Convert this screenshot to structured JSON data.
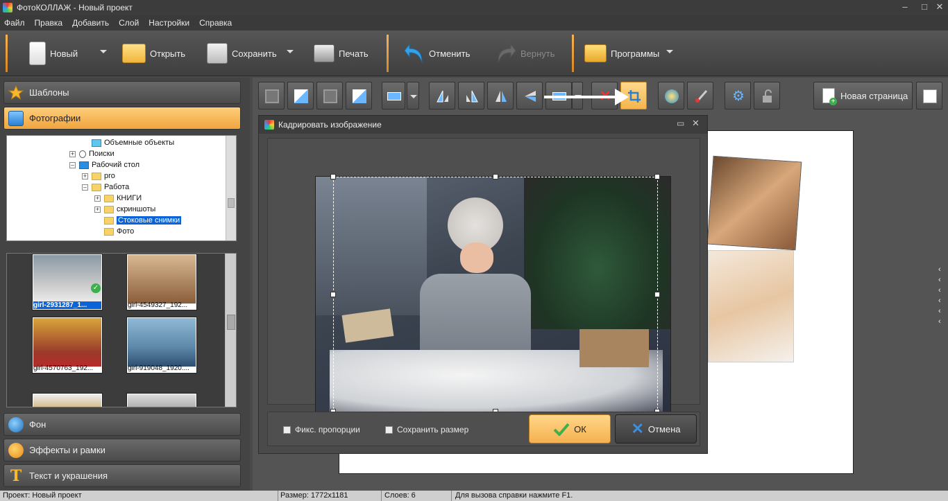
{
  "window": {
    "title": "ФотоКОЛЛАЖ - Новый проект",
    "minimize": "–",
    "maximize": "□",
    "close": "✕"
  },
  "menu": [
    "Файл",
    "Правка",
    "Добавить",
    "Слой",
    "Настройки",
    "Справка"
  ],
  "toolbar": {
    "new": "Новый",
    "open": "Открыть",
    "save": "Сохранить",
    "print": "Печать",
    "undo": "Отменить",
    "redo": "Вернуть",
    "programs": "Программы"
  },
  "left": {
    "templates": "Шаблоны",
    "photos": "Фотографии",
    "background": "Фон",
    "effects": "Эффекты и рамки",
    "text": "Текст и украшения"
  },
  "tree": [
    {
      "label": "Объемные объекты",
      "indent": 7,
      "pm": "",
      "icon": "cube"
    },
    {
      "label": "Поиски",
      "indent": 6,
      "pm": "+",
      "icon": "search"
    },
    {
      "label": "Рабочий стол",
      "indent": 6,
      "pm": "–",
      "icon": "desktop"
    },
    {
      "label": "pro",
      "indent": 7,
      "pm": "+",
      "icon": "folder"
    },
    {
      "label": "Работа",
      "indent": 7,
      "pm": "–",
      "icon": "folder"
    },
    {
      "label": "КНИГИ",
      "indent": 8,
      "pm": "+",
      "icon": "folder"
    },
    {
      "label": "скриншоты",
      "indent": 8,
      "pm": "+",
      "icon": "folder"
    },
    {
      "label": "Стоковые снимки",
      "indent": 8,
      "pm": "",
      "icon": "folder",
      "selected": true
    },
    {
      "label": "Фото",
      "indent": 8,
      "pm": "",
      "icon": "folder"
    }
  ],
  "thumbnails": [
    {
      "label": "girl-2931287_1...",
      "selected": true
    },
    {
      "label": "girl-4549327_192..."
    },
    {
      "label": "girl-4570763_192..."
    },
    {
      "label": "girl-919048_1920...."
    }
  ],
  "edit_toolbar": {
    "new_page": "Новая страница"
  },
  "dialog": {
    "title": "Кадрировать изображение",
    "fix_proportions": "Фикс. пропорции",
    "keep_size": "Сохранить размер",
    "ok": "ОК",
    "cancel": "Отмена"
  },
  "status": {
    "project": "Проект:  Новый проект",
    "size": "Размер:  1772x1181",
    "layers": "Слоев:   6",
    "help": "Для вызова справки нажмите F1."
  }
}
